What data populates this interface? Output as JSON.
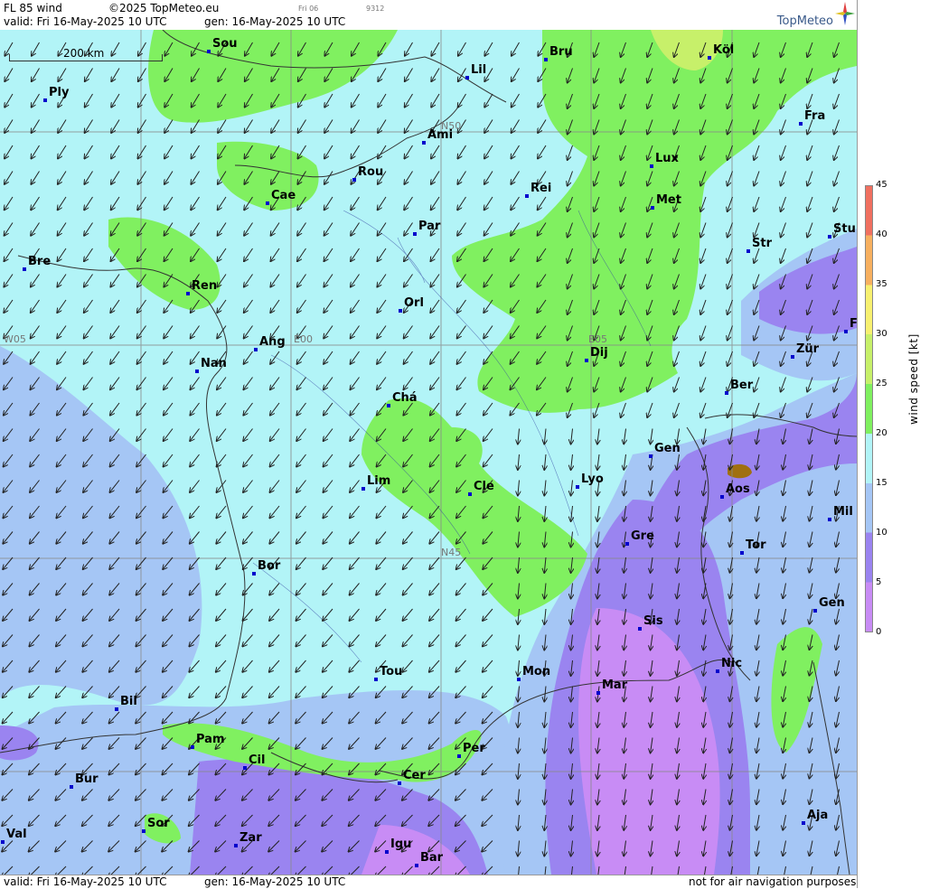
{
  "header": {
    "title": "FL 85 wind",
    "copyright": "©2025 TopMeteo.eu",
    "small_day": "Fri 06",
    "small_code": "9312",
    "valid": "valid:  Fri  16-May-2025  10 UTC",
    "gen": "gen: 16-May-2025 10 UTC",
    "brand": "TopMeteo"
  },
  "footer": {
    "valid": "valid:  Fri  16-May-2025  10 UTC",
    "gen": "gen: 16-May-2025 10 UTC",
    "disclaimer": "not for air navigation purposes"
  },
  "scale_label": "200 km",
  "legend": {
    "title": "wind speed [kt]",
    "ticks": [
      "45",
      "40",
      "35",
      "30",
      "25",
      "20",
      "15",
      "10",
      "5",
      "0"
    ],
    "colors": {
      "0-5": "#c88cf5",
      "5-10": "#9a84f0",
      "10-15": "#a5c6f5",
      "15-20": "#b2f4f7",
      "20-25": "#80f060",
      "25-30": "#c7f06a",
      "30-35": "#f7f070",
      "35-40": "#f7b060",
      "40-45": "#f07060"
    }
  },
  "grid_labels": {
    "n50": "N50",
    "n45": "N45",
    "w05": "W05",
    "e00": "E00",
    "e05": "E05"
  },
  "cities": {
    "sou": "Sou",
    "ply": "Ply",
    "lil": "Lil",
    "bru": "Bru",
    "kol": "Köl",
    "fra": "Fra",
    "ami": "Ami",
    "rou": "Rou",
    "cae": "Cae",
    "lux": "Lux",
    "rei": "Rei",
    "met": "Met",
    "par": "Par",
    "str": "Str",
    "stu": "Stu",
    "bre": "Bre",
    "ren": "Ren",
    "orl": "Orl",
    "ang": "Ang",
    "dij": "Dij",
    "zur": "Zür",
    "nan": "Nan",
    "ber": "Ber",
    "cha": "Chá",
    "gen1": "Gen",
    "lim": "Lim",
    "cle": "Cle",
    "lyo": "Lyo",
    "aos": "Aos",
    "mil": "Mil",
    "bor": "Bor",
    "gre": "Gre",
    "tor": "Tor",
    "gen2": "Gen",
    "sis": "Sis",
    "tou": "Tou",
    "mon": "Mon",
    "mar": "Mar",
    "nic": "Nic",
    "bil": "Bil",
    "pam": "Pam",
    "per": "Per",
    "cil": "Cil",
    "cer": "Cer",
    "bur": "Bur",
    "sor": "Sor",
    "val": "Val",
    "zar": "Zar",
    "igu": "Igu",
    "bar": "Bar",
    "aja": "Aja",
    "f": "F"
  }
}
